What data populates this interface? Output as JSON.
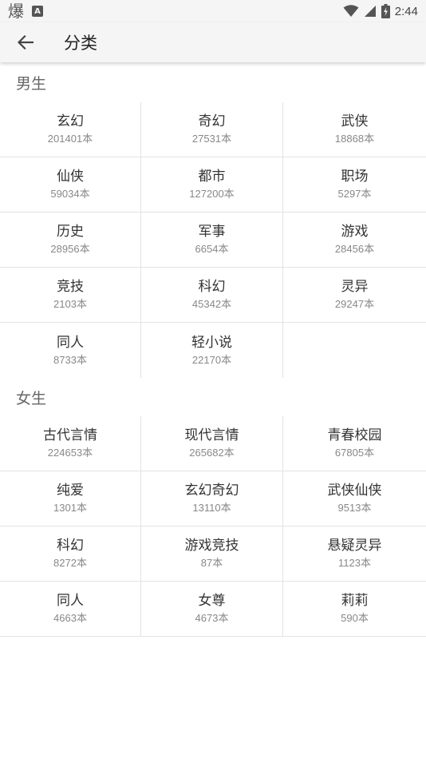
{
  "status_bar": {
    "time": "2:44",
    "app_glyph": "爆",
    "a_badge": "A"
  },
  "app_bar": {
    "title": "分类"
  },
  "sections": [
    {
      "title": "男生",
      "items": [
        {
          "name": "玄幻",
          "count": "201401本"
        },
        {
          "name": "奇幻",
          "count": "27531本"
        },
        {
          "name": "武侠",
          "count": "18868本"
        },
        {
          "name": "仙侠",
          "count": "59034本"
        },
        {
          "name": "都市",
          "count": "127200本"
        },
        {
          "name": "职场",
          "count": "5297本"
        },
        {
          "name": "历史",
          "count": "28956本"
        },
        {
          "name": "军事",
          "count": "6654本"
        },
        {
          "name": "游戏",
          "count": "28456本"
        },
        {
          "name": "竞技",
          "count": "2103本"
        },
        {
          "name": "科幻",
          "count": "45342本"
        },
        {
          "name": "灵异",
          "count": "29247本"
        },
        {
          "name": "同人",
          "count": "8733本"
        },
        {
          "name": "轻小说",
          "count": "22170本"
        }
      ]
    },
    {
      "title": "女生",
      "items": [
        {
          "name": "古代言情",
          "count": "224653本"
        },
        {
          "name": "现代言情",
          "count": "265682本"
        },
        {
          "name": "青春校园",
          "count": "67805本"
        },
        {
          "name": "纯爱",
          "count": "1301本"
        },
        {
          "name": "玄幻奇幻",
          "count": "13110本"
        },
        {
          "name": "武侠仙侠",
          "count": "9513本"
        },
        {
          "name": "科幻",
          "count": "8272本"
        },
        {
          "name": "游戏竞技",
          "count": "87本"
        },
        {
          "name": "悬疑灵异",
          "count": "1123本"
        },
        {
          "name": "同人",
          "count": "4663本"
        },
        {
          "name": "女尊",
          "count": "4673本"
        },
        {
          "name": "莉莉",
          "count": "590本"
        }
      ]
    }
  ]
}
